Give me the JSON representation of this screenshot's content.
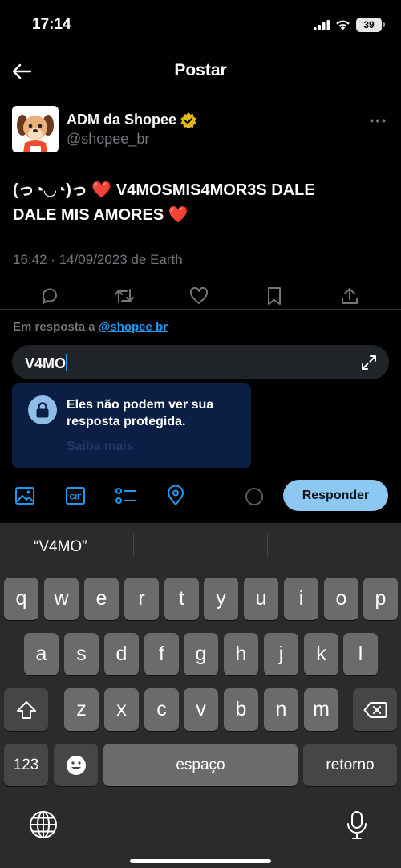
{
  "status_bar": {
    "time": "17:14",
    "battery": "39"
  },
  "header": {
    "title": "Postar"
  },
  "post": {
    "author_name": "ADM da Shopee",
    "author_handle": "@shopee_br",
    "text_line1": "(っ◔◡◔)っ ❤️ V4MOSMIS4MOR3S DALE",
    "text_line2": "DALE MIS AMORES ❤️",
    "meta": "16:42 · 14/09/2023 de Earth"
  },
  "reply": {
    "prefix": "Em resposta a ",
    "handle": "@shopee br",
    "input_value": "V4MO",
    "protected_message": "Eles não podem ver sua resposta protegida.",
    "learn_more": "Saiba mais",
    "submit_label": "Responder"
  },
  "keyboard": {
    "suggestion": "“V4MO”",
    "row1": [
      "q",
      "w",
      "e",
      "r",
      "t",
      "y",
      "u",
      "i",
      "o",
      "p"
    ],
    "row2": [
      "a",
      "s",
      "d",
      "f",
      "g",
      "h",
      "j",
      "k",
      "l"
    ],
    "row3": [
      "z",
      "x",
      "c",
      "v",
      "b",
      "n",
      "m"
    ],
    "numbers_label": "123",
    "space_label": "espaço",
    "return_label": "retorno"
  },
  "colors": {
    "accent": "#1d9bf0",
    "reply_button": "#8cc8f2",
    "verified_gold": "#e2b719"
  }
}
